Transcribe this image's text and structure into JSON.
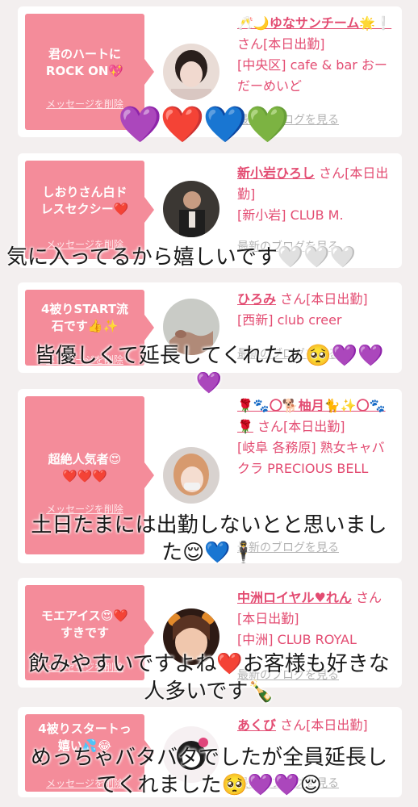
{
  "cards": [
    {
      "message": "君のハートに ROCK ON💖",
      "delete_label": "メッセージを削除",
      "name": "🥂🌙ゆなサンチーム🌟❕",
      "san": " さん[本日出勤]",
      "shop": "[中央区] cafe & bar おーだーめいど",
      "blog_label": "最新のブログを見る"
    },
    {
      "message": "しおりさん白ドレスセクシー❤️",
      "delete_label": "メッセージを削除",
      "name": "新小岩ひろし",
      "san": " さん[本日出勤]",
      "shop": "[新小岩] CLUB M.",
      "blog_label": "最新のブログを見る"
    },
    {
      "message": "4被りSTART流石です👍✨",
      "delete_label": "メッセージを削除",
      "name": "ひろみ",
      "san": " さん[本日出勤]",
      "shop": "[西新] club creer",
      "blog_label": "最新のブログを見る"
    },
    {
      "message": "超絶人気者😍❤️❤️❤️",
      "delete_label": "メッセージを削除",
      "name": "🌹🐾〇🐕柚月🐈✨〇🐾🌹",
      "san": " さん[本日出勤]",
      "shop": "[岐阜 各務原] 熟女キャバクラ PRECIOUS BELL",
      "blog_label": "最新のブログを見る"
    },
    {
      "message": "モエアイス😍❤️すきです",
      "delete_label": "メッセージを削除",
      "name": "中洲ロイヤル♥れん",
      "san": " さん[本日出勤]",
      "shop": "[中洲] CLUB ROYAL",
      "blog_label": "最新のブログを見る"
    },
    {
      "message": "4被りスタートっ嬉い💦😂",
      "delete_label": "メッセージを削除",
      "name": "あくび",
      "san": " さん[本日出勤]",
      "shop": "",
      "blog_label": "最新のブログを見る"
    }
  ],
  "overlays": {
    "hearts_row": "💜❤️💙💚",
    "caption_1": "気に入ってるから嬉しいです🤍🤍🤍",
    "caption_2_line1": "皆優しくて延長してくれたぁ🥺💜💜",
    "caption_2_line2": "💜",
    "caption_3_line1": "土日たまには出勤しないとと思いまし",
    "caption_3_line2": "た😌💙🕴",
    "caption_4_line1": "飲みやすいですよね❤️お客様も好きな",
    "caption_4_line2": "人多いです🍾",
    "caption_5_line1": "めっちゃバタバタでしたが全員延長し",
    "caption_5_line2": "てくれました🥺💜💜😌"
  },
  "colors": {
    "pink_bubble": "#f48c9a",
    "name_pink": "#e34c72",
    "card_bg": "#ffffff",
    "page_bg": "#f3efef"
  }
}
